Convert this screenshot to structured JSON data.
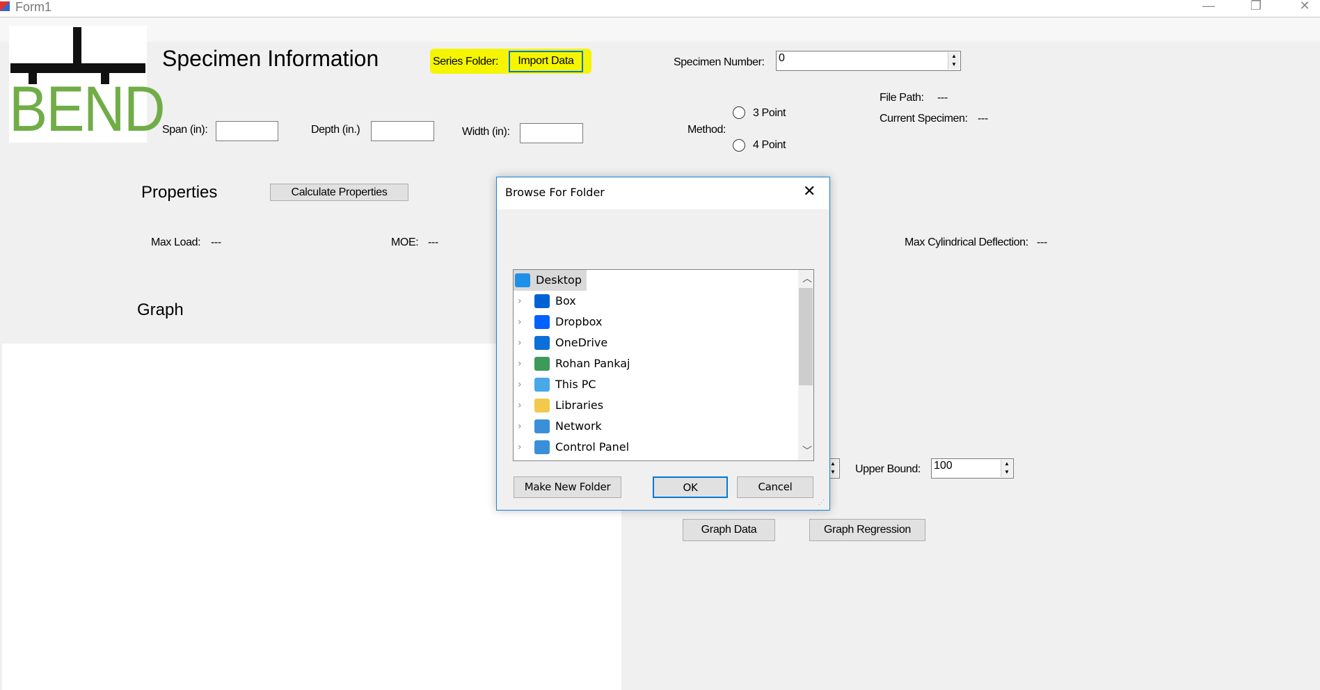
{
  "window": {
    "title": "Form1",
    "minimize": "—",
    "restore": "❐",
    "close": "✕"
  },
  "logo": {
    "text": "BEND",
    "color": "#70ad47"
  },
  "specimen": {
    "heading": "Specimen Information",
    "series_folder_label": "Series Folder:",
    "import_button": "Import Data",
    "highlight_color": "#f5f500",
    "specimen_number_label": "Specimen Number:",
    "specimen_number_value": "0",
    "span_label": "Span (in):",
    "span_value": "",
    "depth_label": "Depth (in.)",
    "depth_value": "",
    "width_label": "Width (in):",
    "width_value": "",
    "method_label": "Method:",
    "method_options": [
      {
        "label": "3 Point",
        "selected": false
      },
      {
        "label": "4 Point",
        "selected": false
      }
    ],
    "file_path_label": "File Path:",
    "file_path_value": "---",
    "current_specimen_label": "Current Specimen:",
    "current_specimen_value": "---"
  },
  "properties": {
    "heading": "Properties",
    "calculate_button": "Calculate Properties",
    "max_load_label": "Max Load:",
    "max_load_value": "---",
    "moe_label": "MOE:",
    "moe_value": "---",
    "max_cyl_label": "Max Cylindrical Deflection:",
    "max_cyl_value": "---"
  },
  "graph": {
    "heading": "Graph",
    "upper_bound_label": "Upper Bound:",
    "upper_bound_value": "100",
    "graph_data_button": "Graph Data",
    "graph_regression_button": "Graph Regression"
  },
  "dialog": {
    "title": "Browse For Folder",
    "close": "✕",
    "items": [
      {
        "label": "Desktop",
        "icon": "desktop-icon",
        "selected": true,
        "color": "#1e90e8"
      },
      {
        "label": "Box",
        "icon": "box-icon",
        "color": "#0061d5"
      },
      {
        "label": "Dropbox",
        "icon": "dropbox-icon",
        "color": "#0061fe"
      },
      {
        "label": "OneDrive",
        "icon": "cloud-icon",
        "color": "#0a6fd8"
      },
      {
        "label": "Rohan Pankaj",
        "icon": "user-icon",
        "color": "#3c9a5a"
      },
      {
        "label": "This PC",
        "icon": "computer-icon",
        "color": "#4aa8e8"
      },
      {
        "label": "Libraries",
        "icon": "library-folder-icon",
        "color": "#f2c94c"
      },
      {
        "label": "Network",
        "icon": "network-icon",
        "color": "#3a8fd8"
      },
      {
        "label": "Control Panel",
        "icon": "control-panel-icon",
        "color": "#3a8fd8"
      }
    ],
    "make_new_folder": "Make New Folder",
    "ok": "OK",
    "cancel": "Cancel"
  }
}
